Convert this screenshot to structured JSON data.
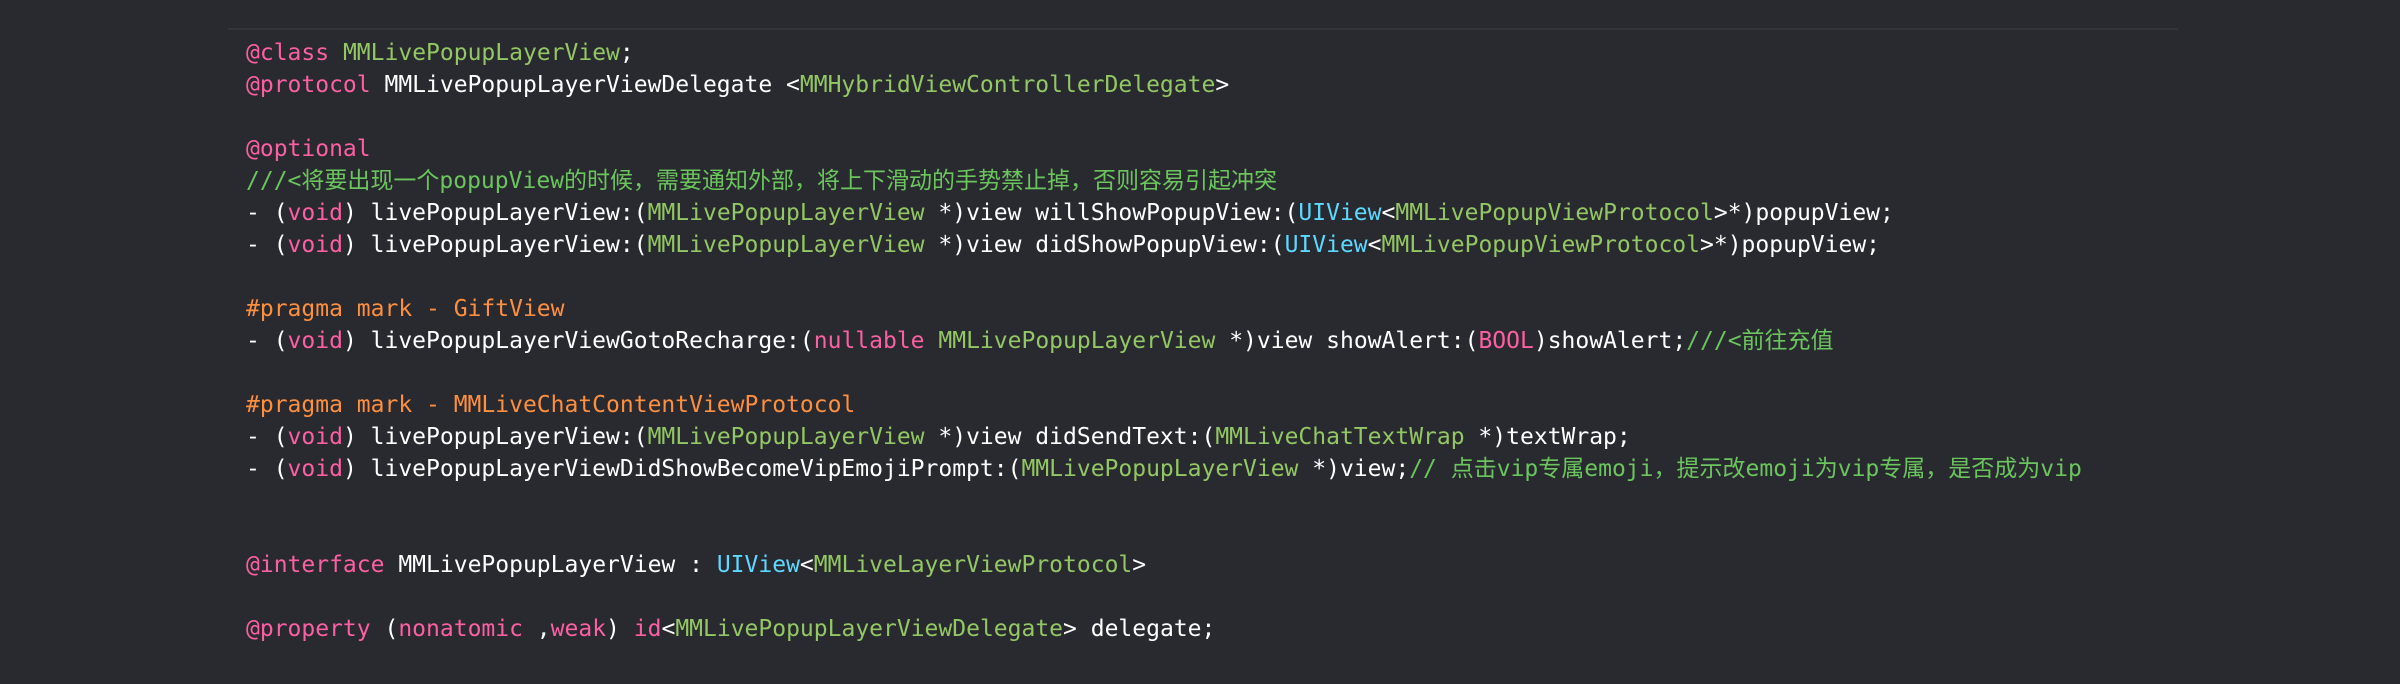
{
  "theme": {
    "background": "#292a30",
    "keyword": "#fc5fa3",
    "type_green": "#93c763",
    "system_type": "#5dd8ff",
    "comment": "#6bc55d",
    "pragma": "#fd8f3f",
    "plain": "#ffffff"
  },
  "lines": [
    [
      {
        "t": "@class",
        "c": "kw"
      },
      {
        "t": " ",
        "c": "plain"
      },
      {
        "t": "MMLivePopupLayerView",
        "c": "tgreen"
      },
      {
        "t": ";",
        "c": "plain"
      }
    ],
    [
      {
        "t": "@protocol",
        "c": "kw"
      },
      {
        "t": " MMLivePopupLayerViewDelegate <",
        "c": "plain"
      },
      {
        "t": "MMHybridViewControllerDelegate",
        "c": "tgreen"
      },
      {
        "t": ">",
        "c": "plain"
      }
    ],
    [],
    [
      {
        "t": "@optional",
        "c": "kw"
      }
    ],
    [
      {
        "t": "///<将要出现一个popupView的时候，需要通知外部，将上下滑动的手势禁止掉，否则容易引起冲突",
        "c": "cmt"
      }
    ],
    [
      {
        "t": "- (",
        "c": "plain"
      },
      {
        "t": "void",
        "c": "kw"
      },
      {
        "t": ") livePopupLayerView:(",
        "c": "plain"
      },
      {
        "t": "MMLivePopupLayerView",
        "c": "tgreen"
      },
      {
        "t": " *)view willShowPopupView:(",
        "c": "plain"
      },
      {
        "t": "UIView",
        "c": "t-cyan"
      },
      {
        "t": "<",
        "c": "plain"
      },
      {
        "t": "MMLivePopupViewProtocol",
        "c": "tgreen"
      },
      {
        "t": ">*)popupView;",
        "c": "plain"
      }
    ],
    [
      {
        "t": "- (",
        "c": "plain"
      },
      {
        "t": "void",
        "c": "kw"
      },
      {
        "t": ") livePopupLayerView:(",
        "c": "plain"
      },
      {
        "t": "MMLivePopupLayerView",
        "c": "tgreen"
      },
      {
        "t": " *)view didShowPopupView:(",
        "c": "plain"
      },
      {
        "t": "UIView",
        "c": "t-cyan"
      },
      {
        "t": "<",
        "c": "plain"
      },
      {
        "t": "MMLivePopupViewProtocol",
        "c": "tgreen"
      },
      {
        "t": ">*)popupView;",
        "c": "plain"
      }
    ],
    [],
    [
      {
        "t": "#pragma mark - GiftView",
        "c": "pragma"
      }
    ],
    [
      {
        "t": "- (",
        "c": "plain"
      },
      {
        "t": "void",
        "c": "kw"
      },
      {
        "t": ") livePopupLayerViewGotoRecharge:(",
        "c": "plain"
      },
      {
        "t": "nullable",
        "c": "kw"
      },
      {
        "t": " ",
        "c": "plain"
      },
      {
        "t": "MMLivePopupLayerView",
        "c": "tgreen"
      },
      {
        "t": " *)view showAlert:(",
        "c": "plain"
      },
      {
        "t": "BOOL",
        "c": "kw"
      },
      {
        "t": ")showAlert;",
        "c": "plain"
      },
      {
        "t": "///<前往充值",
        "c": "cmt"
      }
    ],
    [],
    [
      {
        "t": "#pragma mark - MMLiveChatContentViewProtocol",
        "c": "pragma"
      }
    ],
    [
      {
        "t": "- (",
        "c": "plain"
      },
      {
        "t": "void",
        "c": "kw"
      },
      {
        "t": ") livePopupLayerView:(",
        "c": "plain"
      },
      {
        "t": "MMLivePopupLayerView",
        "c": "tgreen"
      },
      {
        "t": " *)view didSendText:(",
        "c": "plain"
      },
      {
        "t": "MMLiveChatTextWrap",
        "c": "tgreen"
      },
      {
        "t": " *)textWrap;",
        "c": "plain"
      }
    ],
    [
      {
        "t": "- (",
        "c": "plain"
      },
      {
        "t": "void",
        "c": "kw"
      },
      {
        "t": ") livePopupLayerViewDidShowBecomeVipEmojiPrompt:(",
        "c": "plain"
      },
      {
        "t": "MMLivePopupLayerView",
        "c": "tgreen"
      },
      {
        "t": " *)view;",
        "c": "plain"
      },
      {
        "t": "// 点击vip专属emoji，提示改emoji为vip专属，是否成为vip",
        "c": "cmt"
      }
    ],
    [],
    [],
    [
      {
        "t": "@interface",
        "c": "kw"
      },
      {
        "t": " MMLivePopupLayerView : ",
        "c": "plain"
      },
      {
        "t": "UIView",
        "c": "t-cyan"
      },
      {
        "t": "<",
        "c": "plain"
      },
      {
        "t": "MMLiveLayerViewProtocol",
        "c": "tgreen"
      },
      {
        "t": ">",
        "c": "plain"
      }
    ],
    [],
    [
      {
        "t": "@property",
        "c": "kw"
      },
      {
        "t": " (",
        "c": "plain"
      },
      {
        "t": "nonatomic",
        "c": "kw"
      },
      {
        "t": " ,",
        "c": "plain"
      },
      {
        "t": "weak",
        "c": "kw"
      },
      {
        "t": ") ",
        "c": "plain"
      },
      {
        "t": "id",
        "c": "kw"
      },
      {
        "t": "<",
        "c": "plain"
      },
      {
        "t": "MMLivePopupLayerViewDelegate",
        "c": "tgreen"
      },
      {
        "t": "> delegate;",
        "c": "plain"
      }
    ]
  ]
}
